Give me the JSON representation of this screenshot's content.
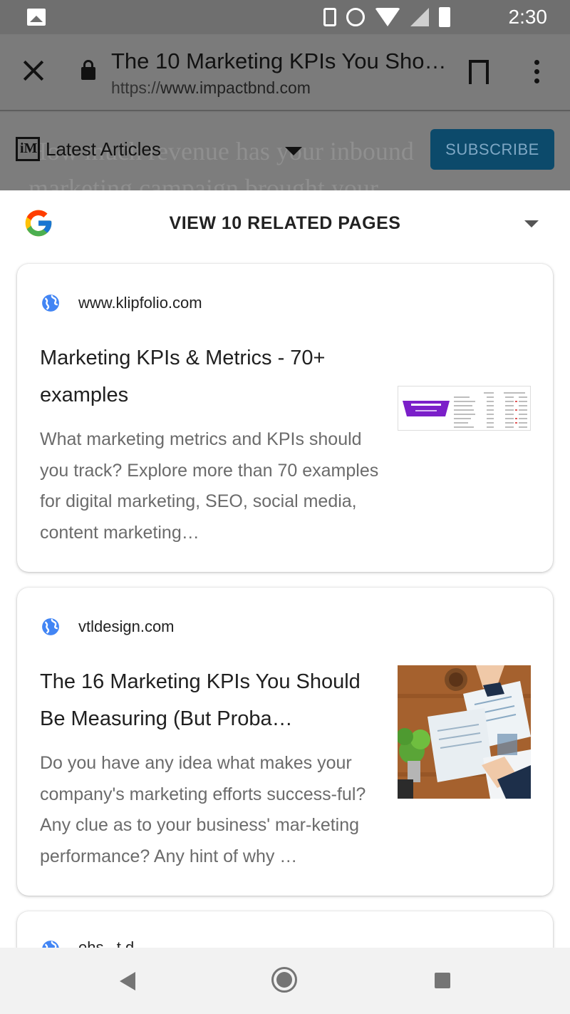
{
  "status_bar": {
    "time": "2:30",
    "icons": [
      "gallery-icon",
      "vibrate-icon",
      "alarm-icon",
      "wifi-icon",
      "signal-icon",
      "battery-icon"
    ]
  },
  "toolbar": {
    "title": "The 10 Marketing KPIs You Sho…",
    "url_scheme": "https://",
    "url_host": "www.impactbnd.com"
  },
  "page_behind": {
    "background_text": "How much revenue has your inbound marketing campaign brought your",
    "nav_label": "Latest Articles",
    "subscribe_label": "SUBSCRIBE"
  },
  "sheet": {
    "title": "VIEW 10 RELATED PAGES",
    "cards": [
      {
        "domain": "www.klipfolio.com",
        "headline": "Marketing KPIs & Metrics - 70+ examples",
        "snippet": "What marketing metrics and KPIs should you track? Explore more than 70 examples for digital marketing, SEO, social media, content marketing…",
        "thumb_label": "AWARENESS"
      },
      {
        "domain": "vtldesign.com",
        "headline": "The 16 Marketing KPIs You Should Be Measuring (But Proba…",
        "snippet": "Do you have any idea what makes your company's marketing efforts success-ful? Any clue as to your business' mar-keting performance? Any hint of why …"
      },
      {
        "domain": "ehs...t.d..."
      }
    ]
  },
  "colors": {
    "subscribe_bg": "#0c4a6b",
    "globe": "#4285f4",
    "thumb_purple": "#7b1fc9"
  }
}
